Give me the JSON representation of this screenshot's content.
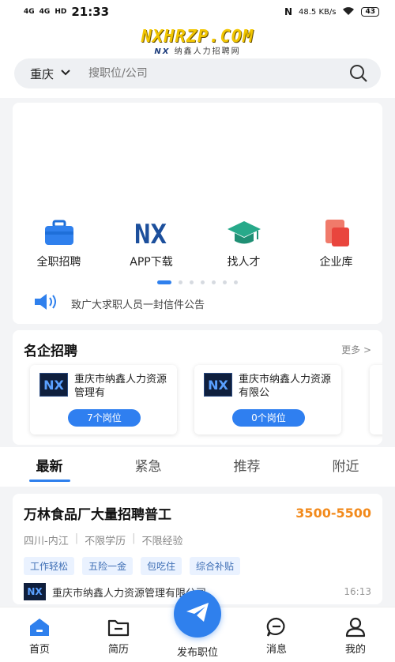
{
  "status_bar": {
    "signal_1": "4G",
    "signal_2": "4G",
    "hd": "HD",
    "time": "21:33",
    "speed": "48.5 KB/s",
    "battery": "43"
  },
  "brand": {
    "logo": "NXHRZP.COM",
    "sub_prefix": "NX",
    "sub_text": "纳鑫人力招聘网"
  },
  "search": {
    "city": "重庆",
    "placeholder": "搜职位/公司"
  },
  "quick_links": [
    {
      "label": "全职招聘",
      "icon": "briefcase-icon"
    },
    {
      "label": "APP下载",
      "icon": "nx-logo-icon"
    },
    {
      "label": "找人才",
      "icon": "graduation-cap-icon"
    },
    {
      "label": "企业库",
      "icon": "company-icon"
    }
  ],
  "notice": "致广大求职人员一封信件公告",
  "featured": {
    "title": "名企招聘",
    "more": "更多 >",
    "firms": [
      {
        "logo": "NX",
        "name": "重庆市纳鑫人力资源管理有",
        "jobs": "7个岗位"
      },
      {
        "logo": "NX",
        "name": "重庆市纳鑫人力资源有限公",
        "jobs": "0个岗位"
      }
    ]
  },
  "tabs": [
    "最新",
    "紧急",
    "推荐",
    "附近"
  ],
  "job": {
    "title": "万林食品厂大量招聘普工",
    "salary": "3500-5500",
    "location": "四川-内江",
    "education": "不限学历",
    "experience": "不限经验",
    "tags": [
      "工作轻松",
      "五险一金",
      "包吃住",
      "综合补贴"
    ],
    "company_logo": "NX",
    "company": "重庆市纳鑫人力资源管理有限公司",
    "time": "16:13"
  },
  "bottom_nav": [
    {
      "label": "首页",
      "icon": "home-icon"
    },
    {
      "label": "简历",
      "icon": "resume-folder-icon"
    },
    {
      "label": "发布职位",
      "icon": "send-icon"
    },
    {
      "label": "消息",
      "icon": "message-icon"
    },
    {
      "label": "我的",
      "icon": "profile-icon"
    }
  ],
  "colors": {
    "accent": "#2f80ed",
    "salary": "#f28a1c",
    "logo_yellow": "#f2c600"
  }
}
